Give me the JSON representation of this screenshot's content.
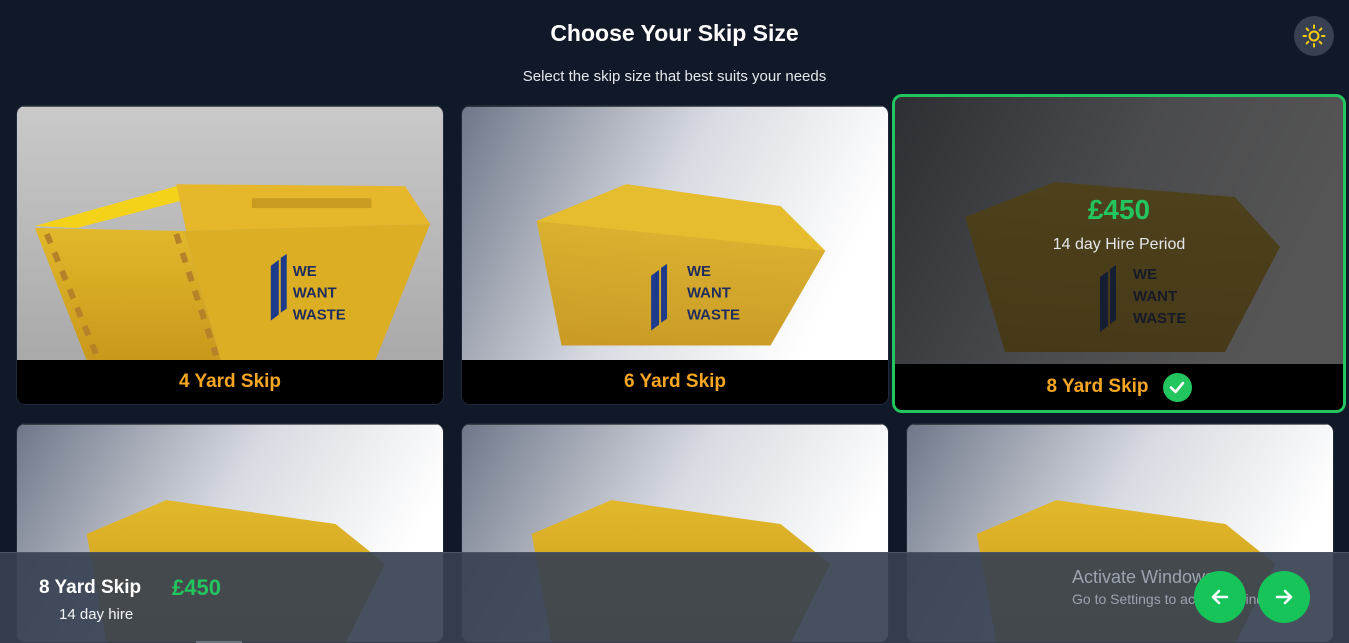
{
  "header": {
    "title": "Choose Your Skip Size",
    "subtitle": "Select the skip size that best suits your needs"
  },
  "theme_toggle": {
    "icon": "sun-icon"
  },
  "skips": [
    {
      "label": "4 Yard Skip",
      "selected": false
    },
    {
      "label": "6 Yard Skip",
      "selected": false
    },
    {
      "label": "8 Yard Skip",
      "selected": true,
      "price": "£450",
      "period": "14 day Hire Period"
    },
    {
      "label": "",
      "selected": false
    },
    {
      "label": "",
      "selected": false
    },
    {
      "label": "",
      "selected": false
    }
  ],
  "skip_brand": [
    "WE",
    "WANT",
    "WASTE"
  ],
  "bottom_bar": {
    "name": "8 Yard Skip",
    "price": "£450",
    "hire": "14 day hire",
    "back_icon": "arrow-left-icon",
    "next_icon": "arrow-right-icon"
  },
  "watermark": {
    "title": "Activate Windows",
    "subtitle": "Go to Settings to activate Windows."
  },
  "colors": {
    "background": "#111827",
    "accent_green": "#22c55e",
    "label_orange": "#f5a623"
  }
}
